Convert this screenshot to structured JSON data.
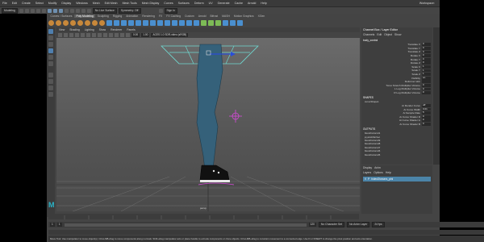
{
  "menubar": {
    "items": [
      "File",
      "Edit",
      "Create",
      "Select",
      "Modify",
      "Display",
      "Windows",
      "Mesh",
      "Edit Mesh",
      "Mesh Tools",
      "Mesh Display",
      "Curves",
      "Surfaces",
      "Deform",
      "UV",
      "Generate",
      "Cache",
      "Arnold",
      "Help"
    ],
    "workspace_label": "Workspace:",
    "workspace_value": "Maya Classic"
  },
  "statusline": {
    "menu_set": "Modeling",
    "live_surface": "No Live Surface",
    "symmetry": "Symmetry: Off",
    "signin": "Sign In"
  },
  "shelf": {
    "tabs": [
      "Curves / Surfaces",
      "Poly Modeling",
      "Sculpting",
      "Rigging",
      "Animation",
      "Rendering",
      "FX",
      "FX Caching",
      "Custom",
      "Arnold",
      "Bifrost",
      "MASH",
      "Motion Graphics",
      "XGen"
    ],
    "active_tab": 1
  },
  "viewport": {
    "menus": [
      "View",
      "Shading",
      "Lighting",
      "Show",
      "Renderer",
      "Panels"
    ],
    "field_a": "0.00",
    "field_b": "1.00",
    "color_space": "ACES 1.0 SDR-video (sRGB)",
    "camera_label": "persp"
  },
  "channelbox": {
    "title": "Channel Box / Layer Editor",
    "tabs": [
      "Channels",
      "Edit",
      "Object",
      "Show"
    ],
    "object_name": "body_control",
    "attrs": [
      {
        "label": "Translate X",
        "value": "0"
      },
      {
        "label": "Translate Y",
        "value": "0"
      },
      {
        "label": "Translate Z",
        "value": "0"
      },
      {
        "label": "Rotate X",
        "value": "0"
      },
      {
        "label": "Rotate Y",
        "value": "0"
      },
      {
        "label": "Rotate Z",
        "value": "0"
      },
      {
        "label": "Scale X",
        "value": "1"
      },
      {
        "label": "Scale Y",
        "value": "1"
      },
      {
        "label": "Scale Z",
        "value": "1"
      },
      {
        "label": "Visibility",
        "value": "on"
      },
      {
        "label": "Deformer skin",
        "value": ""
      },
      {
        "label": "Torus Stretch Multiplier Volume",
        "value": "0"
      },
      {
        "label": "L Leg Multiplier Volume",
        "value": "0"
      },
      {
        "label": "R Leg Multiplier Volume",
        "value": "0"
      }
    ],
    "shapes_label": "SHAPES",
    "shape_name": "curveShape1",
    "shape_attrs": [
      {
        "label": "Ai Render Curve",
        "value": "off"
      },
      {
        "label": "Ai Curve Width",
        "value": "0.01"
      },
      {
        "label": "Ai Sample Rate",
        "value": "5"
      },
      {
        "label": "Ai Curve Shader R",
        "value": "0"
      },
      {
        "label": "Ai Curve Shader G",
        "value": "0"
      },
      {
        "label": "Ai Curve Shader B",
        "value": "0"
      }
    ],
    "outputs_label": "OUTPUTS",
    "outputs": [
      "blendColors41",
      "joystickSinVec",
      "blendColors49",
      "blendColors48",
      "blendColors47",
      "blendColors46",
      "blendColors45"
    ]
  },
  "layereditor": {
    "tabs": [
      "Display",
      "Anim"
    ],
    "menus": [
      "Layers",
      "Options",
      "Help"
    ],
    "layer_name": "hidesShowers_ptnl"
  },
  "timeslider": {
    "start": "1",
    "end": "120",
    "current": "1",
    "no_character_set": "No Character Set",
    "no_anim_layer": "No Anim Layer",
    "fps": "24 fps"
  },
  "helpline": {
    "text": "Move Tool: Use manipulator to move object(s). Ctrl+LMB-drag to move components along normals. Shift+drag manipulator axis or plane handle to extrude components or clone objects. Ctrl+LMB+drag to constrain movement to a connected edge. Use D or INSERT to change the pivot position and axis orientation."
  },
  "colors": {
    "leg": "#35617a",
    "control": "#d54ad8",
    "cage": "#6fd8d0",
    "layer_row": "#4b84a8",
    "maya_logo": "#2ab3c8"
  }
}
